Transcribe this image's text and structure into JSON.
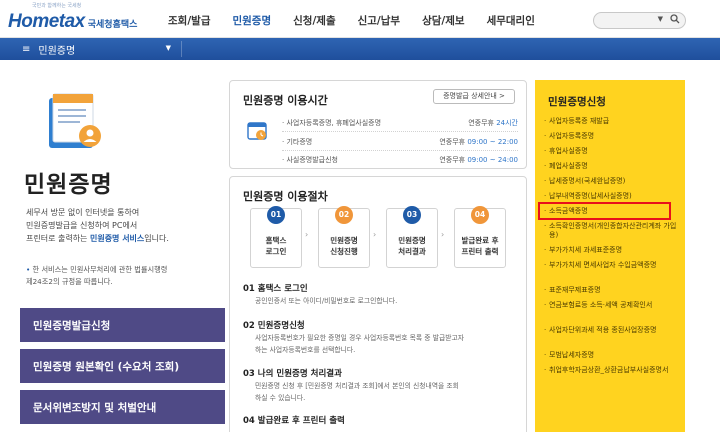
{
  "header": {
    "logo_main": "Hometax",
    "logo_sub": "국세청홈택스",
    "logo_tagline": "국민과 함께하는 국세청",
    "nav": [
      {
        "label": "조회/발급",
        "active": false
      },
      {
        "label": "민원증명",
        "active": true
      },
      {
        "label": "신청/제출",
        "active": false
      },
      {
        "label": "신고/납부",
        "active": false
      },
      {
        "label": "상담/제보",
        "active": false
      },
      {
        "label": "세무대리인",
        "active": false
      }
    ],
    "search_icon": "search-icon"
  },
  "menu_bar": {
    "current_menu": "민원증명"
  },
  "left": {
    "page_title": "민원증명",
    "intro_1": "세무서 방문 없이 인터넷을 통하여",
    "intro_2": "민원증명발급을 신청하여 PC에서",
    "intro_3a": "프린터로 출력하는 ",
    "intro_3b": "민원증명 서비스",
    "intro_3c": "입니다.",
    "note_1": "한 서비스는 민원사무처리에 관한 법률시행령",
    "note_2": "제24조2의 규정을 따릅니다.",
    "buttons": [
      "민원증명발급신청",
      "민원증명 원본확인 (수요처 조회)",
      "문서위변조방지 및 처벌안내"
    ]
  },
  "hours_card": {
    "title": "민원증명 이용시간",
    "guide_button": "증명발급 상세안내 >",
    "rows": [
      {
        "label": "· 사업자등록증명, 휴폐업사실증명",
        "prefix": "연중무휴 ",
        "time": "24시간"
      },
      {
        "label": "· 기타증명",
        "prefix": "연중무휴 ",
        "time": "09:00 ~ 22:00"
      },
      {
        "label": "· 사실증명발급신청",
        "prefix": "연중무휴 ",
        "time": "09:00 ~ 24:00"
      }
    ]
  },
  "procedure_card": {
    "title": "민원증명 이용절차",
    "steps": [
      {
        "num": "01",
        "label": "홈택스\n로그인",
        "color": "#1f5ba8"
      },
      {
        "num": "02",
        "label": "민원증명\n신청진행",
        "color": "#f0963a"
      },
      {
        "num": "03",
        "label": "민원증명\n처리결과",
        "color": "#1f5ba8"
      },
      {
        "num": "04",
        "label": "발급완료 후\n프린터 출력",
        "color": "#f0963a"
      }
    ],
    "sections": [
      {
        "heading": "01 홈택스 로그인",
        "lines": [
          "공인인증서 또는 아이디/비밀번호로 로그인합니다."
        ]
      },
      {
        "heading": "02 민원증명신청",
        "lines": [
          "사업자등록번호가 필요한 증명일 경우 사업자등록번호 목록 중 발급받고자",
          "하는 사업자등록번호를 선택합니다."
        ]
      },
      {
        "heading": "03 나의 민원증명 처리결과",
        "lines": [
          "민원증명 신청 후 [민원증명 처리결과 조회]에서 본인의 신청내역을 조회",
          "하실 수 있습니다."
        ]
      },
      {
        "heading": "04 발급완료 후 프린터 출력",
        "lines": []
      }
    ]
  },
  "right_panel": {
    "title": "민원증명신청",
    "items": [
      "사업자등록증 재발급",
      "사업자등록증명",
      "휴업사실증명",
      "폐업사실증명",
      "납세증명서(국세완납증명)",
      "납부내역증명(납세사실증명)",
      "소득금액증명",
      "소득확인증명서(개인종합자산관리계좌 가입용)",
      "부가가치세 과세표준증명",
      "부가가치세 면세사업자 수입금액증명",
      "표준재무제표증명",
      "연금보험료등 소득·세액 공제확인서",
      "사업자단위과세 적용 종된사업장증명",
      "모범납세자증명",
      "취업후학자금상환_상환금납부사실증명서"
    ],
    "highlighted_item": "소득금액증명",
    "highlight_color": "#e8111b"
  }
}
